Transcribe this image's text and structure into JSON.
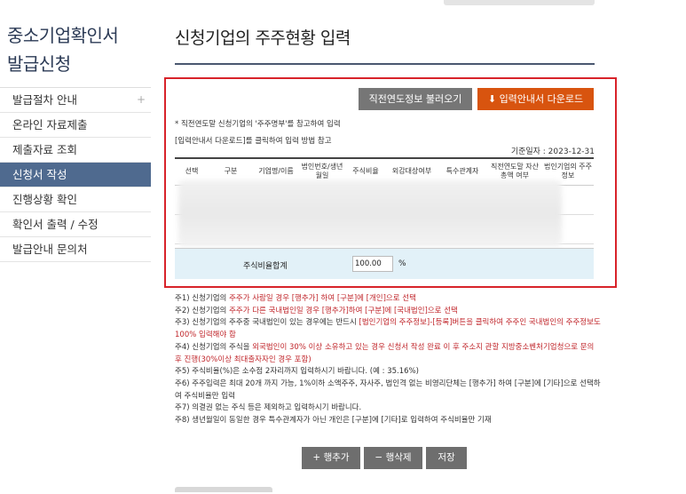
{
  "sidebar": {
    "title_line1": "중소기업확인서",
    "title_line2": "발급신청",
    "items": [
      {
        "label": "발급절차 안내",
        "plus": "+"
      },
      {
        "label": "온라인 자료제출"
      },
      {
        "label": "제출자료 조회"
      },
      {
        "label": "신청서 작성"
      },
      {
        "label": "진행상황 확인"
      },
      {
        "label": "확인서 출력 / 수정"
      },
      {
        "label": "발급안내 문의처"
      }
    ]
  },
  "page": {
    "title": "신청기업의 주주현황 입력"
  },
  "toolbar": {
    "load_label": "직전연도정보 불러오기",
    "download_label": "입력안내서 다운로드"
  },
  "guide": {
    "line1": "* 직전연도말 신청기업의 '주주명부'를 참고하여 입력",
    "line2": "[입력안내서 다운로드]를 클릭하여 입력 방법 참고",
    "base_date": "기준일자 : 2023-12-31"
  },
  "table": {
    "headers": [
      "선택",
      "구분",
      "기업명/이름",
      "법인번호/생년월일",
      "주식비율",
      "외감대상여부",
      "특수관계자",
      "직전연도말 자산총액 여부",
      "법인기업의 주주정보"
    ],
    "sum_label": "주식비율합계",
    "sum_value": "100.00",
    "sum_unit": "%"
  },
  "notes": {
    "n1a": "주1) 신청기업의 ",
    "n1b": "주주가 사람일 경우 [행추가] 하여 [구분]에 [개인]으로 선택",
    "n2a": "주2) 신청기업의 ",
    "n2b": "주주가 다른 국내법인일 경우 [행추가]하여 [구분]에 [국내법인]으로 선택",
    "n3a": "주3) 신청기업의 주주중 국내법인이 있는 경우에는 반드시 ",
    "n3b": "[법인기업의 주주정보]-[등록]버튼을 클릭하여 주주인 국내법인의 주주정보도 100% 입력해야 함",
    "n4a": "주4) 신청기업의 주식을 ",
    "n4b": "외국법인이 30% 이상 소유하고 있는 경우 신청서 작성 완료 이 후 주소지 관할 지방중소벤처기업청으로 문의 후 진행(30%이상 최대출자자인 경우 포함)",
    "n5": "주5) 주식비율(%)은 소수점 2자리까지 입력하시기 바랍니다. (예 : 35.16%)",
    "n6": "주6) 주주입력은 최대 20개 까지 가능, 1%이하 소액주주, 자사주, 법인격 없는 비영리단체는 [행추가] 하여 [구분]에 [기타]으로 선택하여 주식비율만 입력",
    "n7": "주7) 의결권 없는 주식 등은 제외하고 입력하시기 바랍니다.",
    "n8": "주8) 생년월일이 동일한 경우 특수관계자가 아닌 개인은 [구분]에 [기타]로 입력하여 주식비율만 기재"
  },
  "actions": {
    "add_row": "행추가",
    "delete_row": "행삭제",
    "save": "저장"
  },
  "colors": {
    "accent_orange": "#d8540f",
    "highlight_red": "#d8232a",
    "sidebar_active": "#4f6a8f"
  }
}
